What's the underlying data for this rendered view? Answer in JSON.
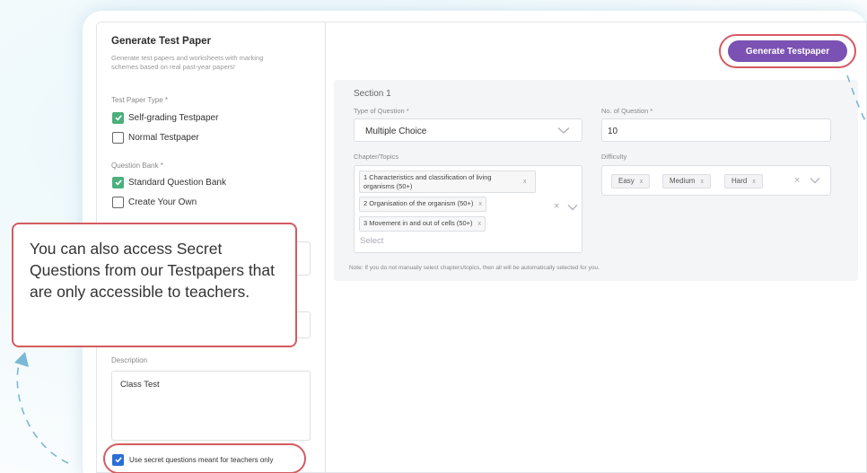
{
  "left_panel": {
    "title": "Generate Test Paper",
    "subtitle": "Generate test papers and worksheets with marking schemes based on real past-year papers!",
    "paper_type_label": "Test Paper Type *",
    "paper_types": [
      {
        "label": "Self-grading Testpaper",
        "checked": true
      },
      {
        "label": "Normal Testpaper",
        "checked": false
      }
    ],
    "question_bank_label": "Question Bank *",
    "question_banks": [
      {
        "label": "Standard Question Bank",
        "checked": true
      },
      {
        "label": "Create Your Own",
        "checked": false
      }
    ],
    "description_label": "Description",
    "description_value": "Class Test",
    "secret_label": "Use secret questions meant for teachers only",
    "secret_checked": true
  },
  "toolbar": {
    "generate_label": "Generate Testpaper"
  },
  "section": {
    "title": "Section 1",
    "type_label": "Type of Question *",
    "type_value": "Multiple Choice",
    "count_label": "No. of Question *",
    "count_value": "10",
    "chapter_label": "Chapter/Topics",
    "chapters": [
      "1 Characteristics and classification of living organisms (50+)",
      "2 Organisation of the organism (50+)",
      "3 Movement in and out of cells (50+)"
    ],
    "chapter_placeholder": "Select",
    "difficulty_label": "Difficulty",
    "difficulties": [
      "Easy",
      "Medium",
      "Hard"
    ],
    "note": "Note: If you do not manually select chapters/topics, then all will be automatically selected for you."
  },
  "callout": {
    "text": "You can also access Secret Questions from our Testpapers that are only accessible to teachers."
  },
  "colors": {
    "accent_purple": "#7b52b3",
    "highlight_red": "#d45b60",
    "check_green": "#4caf7d",
    "check_blue": "#2a6fd6",
    "dash_blue": "#7ab8d6"
  }
}
